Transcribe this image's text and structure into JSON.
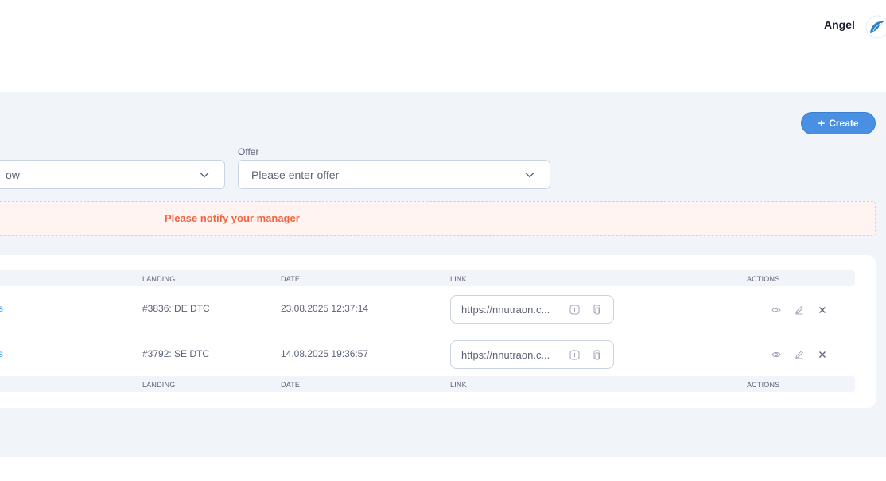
{
  "header": {
    "user_name": "Angel"
  },
  "toolbar": {
    "create_label": "Create"
  },
  "filters": {
    "first_select_value": "ow",
    "offer_label": "Offer",
    "offer_placeholder": "Please enter offer"
  },
  "alert": {
    "text": "Please notify your manager"
  },
  "table": {
    "columns": {
      "landing": "LANDING",
      "date": "DATE",
      "link": "LINK",
      "actions": "ACTIONS"
    },
    "rows": [
      {
        "id_fragment": "s",
        "landing": "#3836: DE DTC",
        "date": "23.08.2025 12:37:14",
        "link": "https://nnutraon.c..."
      },
      {
        "id_fragment": "s",
        "landing": "#3792: SE DTC",
        "date": "14.08.2025 19:36:57",
        "link": "https://nnutraon.c..."
      }
    ]
  },
  "icons": {
    "create": "plus-icon",
    "select": "chevron-down-icon",
    "link_info": "info-icon",
    "link_copy": "copy-icon",
    "view": "eye-icon",
    "edit": "pencil-icon",
    "delete": "close-icon"
  },
  "colors": {
    "accent": "#4a90e2",
    "alert_text": "#f1653f",
    "alert_bg": "#fff4f2",
    "page_bg": "#f1f5f9",
    "link": "#3e97ff"
  }
}
